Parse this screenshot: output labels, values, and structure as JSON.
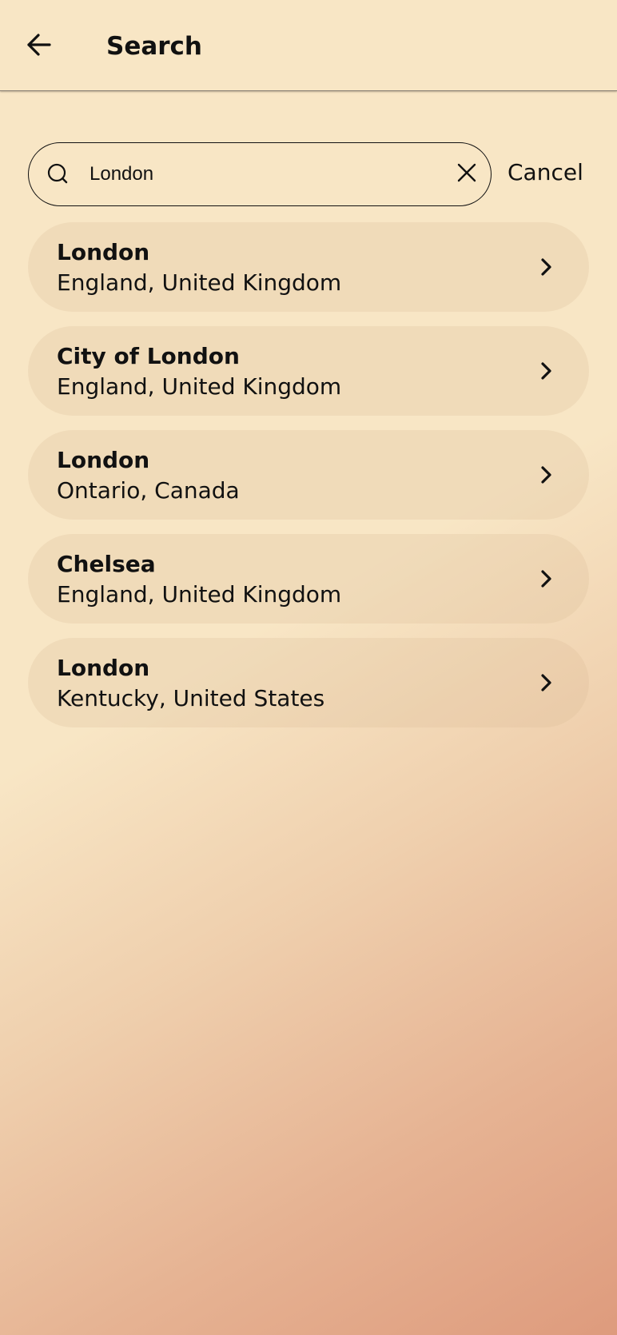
{
  "header": {
    "title": "Search",
    "back_icon": "arrow-left-icon"
  },
  "search": {
    "value": "London",
    "placeholder": "",
    "search_icon": "search-icon",
    "clear_icon": "close-icon",
    "cancel_label": "Cancel"
  },
  "results": [
    {
      "name": "London",
      "region": "England, United Kingdom",
      "icon": "chevron-right-icon"
    },
    {
      "name": "City of London",
      "region": "England, United Kingdom",
      "icon": "chevron-right-icon"
    },
    {
      "name": "London",
      "region": "Ontario, Canada",
      "icon": "chevron-right-icon"
    },
    {
      "name": "Chelsea",
      "region": "England, United Kingdom",
      "icon": "chevron-right-icon"
    },
    {
      "name": "London",
      "region": "Kentucky, United States",
      "icon": "chevron-right-icon"
    }
  ],
  "colors": {
    "background_top": "#f8e6c5",
    "background_bottom": "#de9b7d",
    "card": "#efdcbc",
    "text": "#111111"
  }
}
